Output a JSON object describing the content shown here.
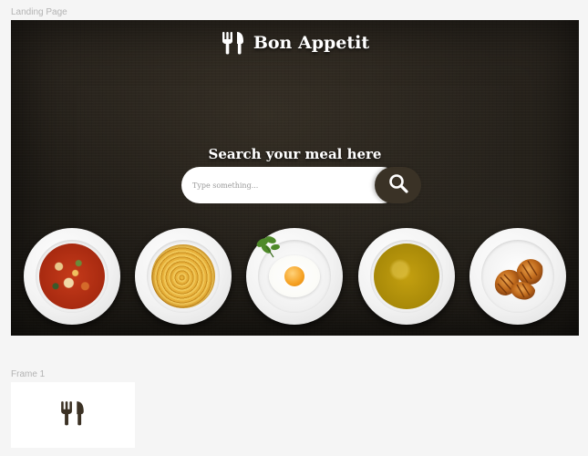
{
  "canvas": {
    "frames": [
      {
        "label": "Landing Page"
      },
      {
        "label": "Frame 1"
      }
    ]
  },
  "landing": {
    "brand": {
      "icon": "fork-knife-icon",
      "name": "Bon Appetit"
    },
    "search": {
      "heading": "Search your meal here",
      "placeholder": "Type something...",
      "button_icon": "search-icon"
    },
    "plates": [
      {
        "name": "vegetable-tomato-soup"
      },
      {
        "name": "spaghetti"
      },
      {
        "name": "fried-egg"
      },
      {
        "name": "yellow-soup"
      },
      {
        "name": "croissants"
      }
    ]
  },
  "frame1": {
    "icon": "fork-knife-icon"
  },
  "colors": {
    "canvas_bg": "#f5f5f5",
    "hero_bg": "#221e18",
    "search_button": "#3a3226",
    "icon_dark": "#3b3124",
    "text_light": "#ffffff"
  }
}
